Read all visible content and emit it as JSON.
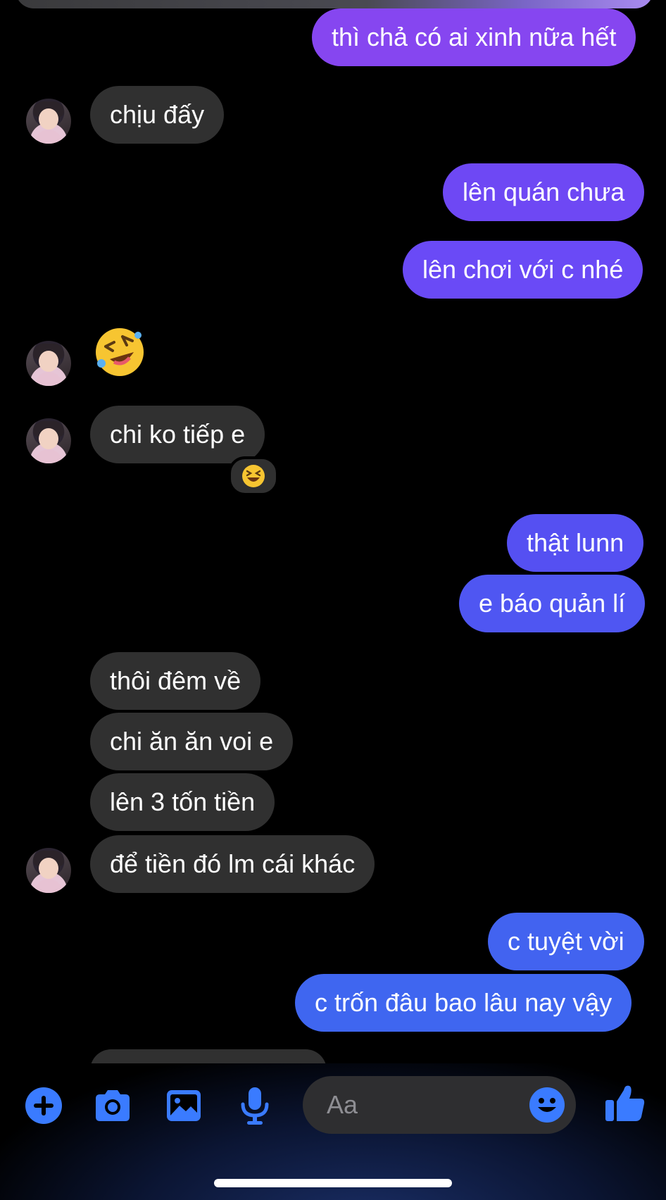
{
  "colors": {
    "background": "#000000",
    "incoming_bubble": "#303030",
    "outgoing_gradient": [
      "#8a4cf2",
      "#6a4cf6",
      "#5b52f4",
      "#4f5bf0",
      "#4168f0"
    ],
    "icon_blue": "#3a7bff"
  },
  "messages": [
    {
      "side": "out",
      "text": "thì chả có ai xinh nữa hết"
    },
    {
      "side": "in",
      "text": "chịu đấy",
      "avatar": true
    },
    {
      "side": "out",
      "text": "lên quán chưa"
    },
    {
      "side": "out",
      "text": "lên chơi với c nhé"
    },
    {
      "side": "in",
      "emoji": "rolling-on-floor-laughing",
      "avatar": true
    },
    {
      "side": "in",
      "text": "chi ko tiếp e",
      "avatar": true,
      "reaction": "grinning-squinting-face"
    },
    {
      "side": "out",
      "text": "thật lunn"
    },
    {
      "side": "out",
      "text": "e báo quản lí"
    },
    {
      "side": "in",
      "text": "thôi đêm về"
    },
    {
      "side": "in",
      "text": "chi ăn ăn voi e"
    },
    {
      "side": "in",
      "text": "lên 3 tốn tiền"
    },
    {
      "side": "in",
      "text": "để tiền đó lm cái khác",
      "avatar": true
    },
    {
      "side": "out",
      "text": "c tuyệt vời"
    },
    {
      "side": "out",
      "text": "c trốn đâu bao lâu nay vậy"
    }
  ],
  "composer": {
    "placeholder": "Aa",
    "icons": [
      "plus-icon",
      "camera-icon",
      "gallery-icon",
      "microphone-icon",
      "emoji-icon",
      "thumbs-up-icon"
    ]
  }
}
